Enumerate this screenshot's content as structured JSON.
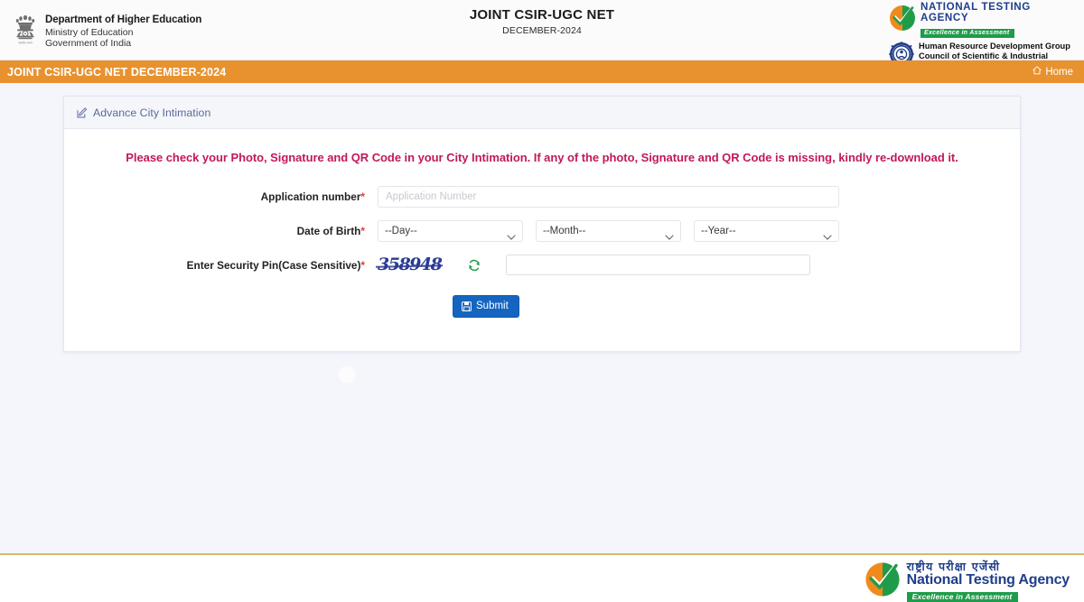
{
  "header": {
    "emblem_icon": "india-state-emblem-icon",
    "gov_line1": "Department of Higher Education",
    "gov_line2": "Ministry of Education",
    "gov_line3": "Government of India",
    "exam_title": "JOINT CSIR-UGC NET",
    "exam_session": "DECEMBER-2024",
    "nta_icon": "nta-tick-logo-icon",
    "nta_name": "NATIONAL TESTING AGENCY",
    "nta_tagline": "Excellence in Assessment",
    "csir_icon": "csir-gear-logo-icon",
    "csir_line1": "Human Resource Development Group",
    "csir_line2": "Council of Scientific & Industrial Research"
  },
  "navbar": {
    "brand": "JOINT CSIR-UGC NET DECEMBER-2024",
    "home_label": "Home",
    "home_icon": "home-icon",
    "background_color": "#e8922f"
  },
  "card": {
    "header_icon": "edit-pencil-icon",
    "header_title": "Advance City Intimation",
    "alert_message": "Please check your Photo, Signature and QR Code in your City Intimation. If any of the photo, Signature and QR Code is missing, kindly re-download it.",
    "alert_color": "#c2185b"
  },
  "form": {
    "application_number": {
      "label": "Application number",
      "required_marker": "*",
      "placeholder": "Application Number",
      "value": ""
    },
    "date_of_birth": {
      "label": "Date of Birth",
      "required_marker": "*",
      "day": {
        "selected": "--Day--",
        "options": [
          "--Day--"
        ]
      },
      "month": {
        "selected": "--Month--",
        "options": [
          "--Month--"
        ]
      },
      "year": {
        "selected": "--Year--",
        "options": [
          "--Year--"
        ]
      }
    },
    "security_pin": {
      "label": "Enter Security Pin(Case Sensitive)",
      "required_marker": "*",
      "captcha_text": "358948",
      "captcha_color": "#2a3a96",
      "refresh_icon": "refresh-icon",
      "input_value": "",
      "input_placeholder": ""
    },
    "submit": {
      "label": "Submit",
      "icon": "save-disk-icon",
      "background_color": "#1565c0"
    }
  },
  "footer": {
    "logo_icon": "nta-tick-logo-icon",
    "hindi_name": "राष्ट्रीय  परीक्षा  एजेंसी",
    "english_name": "National Testing Agency",
    "tagline": "Excellence in Assessment",
    "divider_color": "#d9b86a"
  }
}
